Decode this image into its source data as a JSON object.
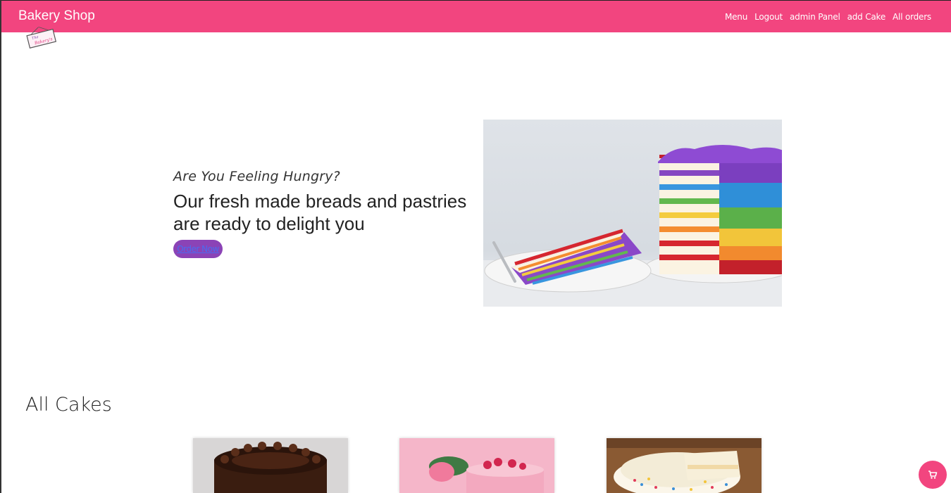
{
  "navbar": {
    "brand": "Bakery Shop",
    "links": [
      "Menu",
      "Logout",
      "admin Panel",
      "add Cake",
      "All orders"
    ]
  },
  "logo": {
    "icon": "bakery-logo-icon",
    "lines": [
      "The",
      "Bakery's"
    ]
  },
  "hero": {
    "tagline": "Are You Feeling Hungry?",
    "headline": "Our fresh made breads and pastries are ready to delight you",
    "button_label": "Order Now",
    "image": "rainbow-cake-image"
  },
  "cakes": {
    "title": "All Cakes",
    "items": [
      {
        "image": "chocolate-cake-image"
      },
      {
        "image": "pink-raspberry-cake-image"
      },
      {
        "image": "vanilla-sprinkle-cake-image"
      }
    ]
  },
  "cart": {
    "icon": "cart-icon"
  },
  "colors": {
    "brand_pink": "#f2457f",
    "button_purple": "#8b43b6"
  }
}
